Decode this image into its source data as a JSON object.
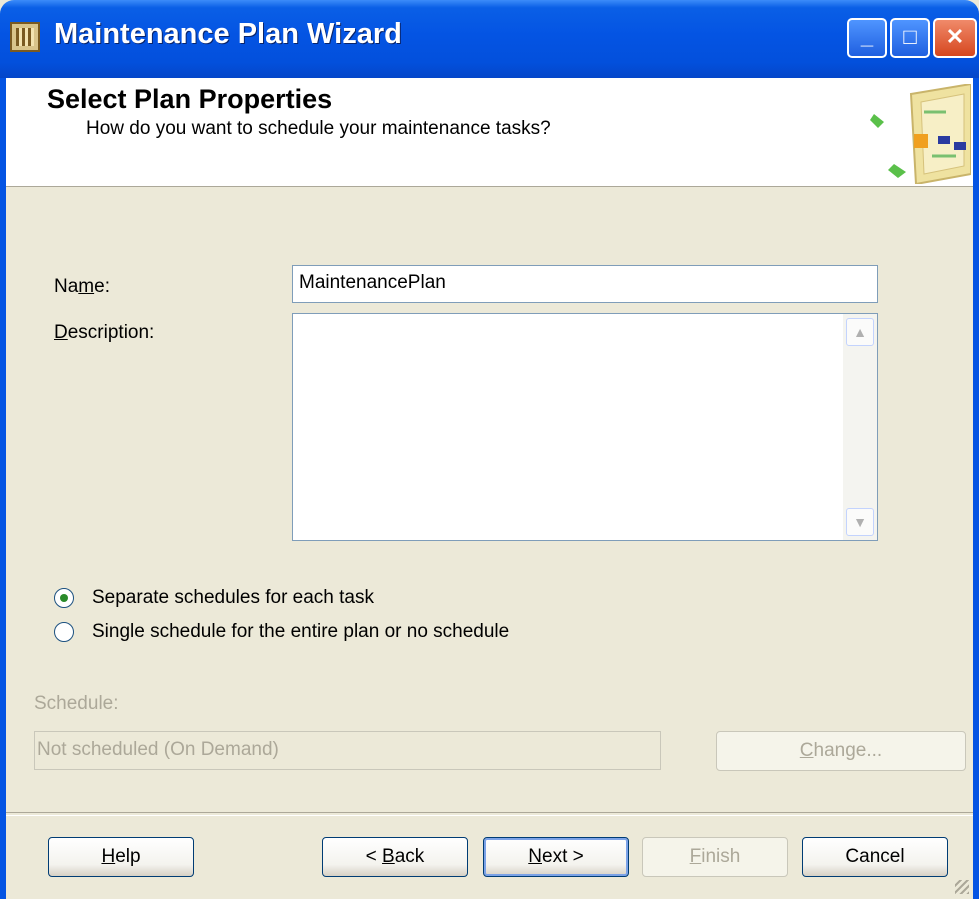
{
  "window": {
    "title": "Maintenance Plan Wizard",
    "controls": {
      "minimize": "_",
      "maximize": "□",
      "close": "✕"
    }
  },
  "header": {
    "title": "Select Plan Properties",
    "subtitle": "How do you want to schedule your maintenance tasks?",
    "art_icon": "wizard-plan-icon"
  },
  "form": {
    "name_label_pre": "Na",
    "name_label_u": "m",
    "name_label_post": "e:",
    "name_value": "MaintenancePlan",
    "description_label_pre": "",
    "description_label_u": "D",
    "description_label_post": "escription:",
    "description_value": ""
  },
  "schedule_options": [
    {
      "label": "Separate schedules for each task",
      "checked": true
    },
    {
      "label": "Single schedule for the entire plan or no schedule",
      "checked": false
    }
  ],
  "schedule": {
    "label": "Schedule:",
    "value": "Not scheduled (On Demand)",
    "change_pre": "",
    "change_u": "C",
    "change_post": "hange..."
  },
  "footer": {
    "help_u": "H",
    "help_post": "elp",
    "back_pre": "< ",
    "back_u": "B",
    "back_post": "ack",
    "next_u": "N",
    "next_post": "ext >",
    "finish_u": "F",
    "finish_post": "inish",
    "cancel": "Cancel"
  },
  "colors": {
    "titlebar": "#0454e3",
    "dialog_bg": "#ece9d8",
    "disabled_text": "#aca899",
    "radio_dot": "#2a8a2a"
  }
}
